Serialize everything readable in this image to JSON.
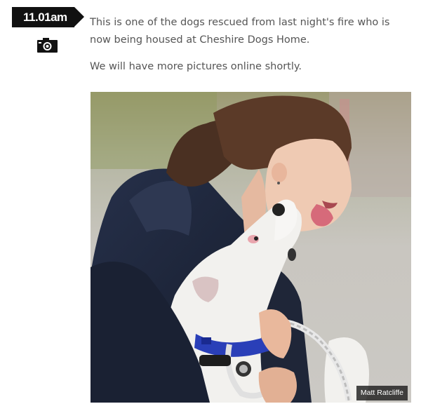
{
  "entry": {
    "time": "11.01am",
    "icon": "camera-icon",
    "paragraphs": [
      "This is one of the dogs rescued from last night's fire who is now being housed at Cheshire Dogs Home.",
      "We will have more pictures online shortly."
    ],
    "photo": {
      "credit": "Matt Ratcliffe"
    }
  },
  "colors": {
    "badge": "#111111",
    "text": "#555555",
    "collar": "#2a3fb8",
    "hoodie": "#1d2535"
  }
}
